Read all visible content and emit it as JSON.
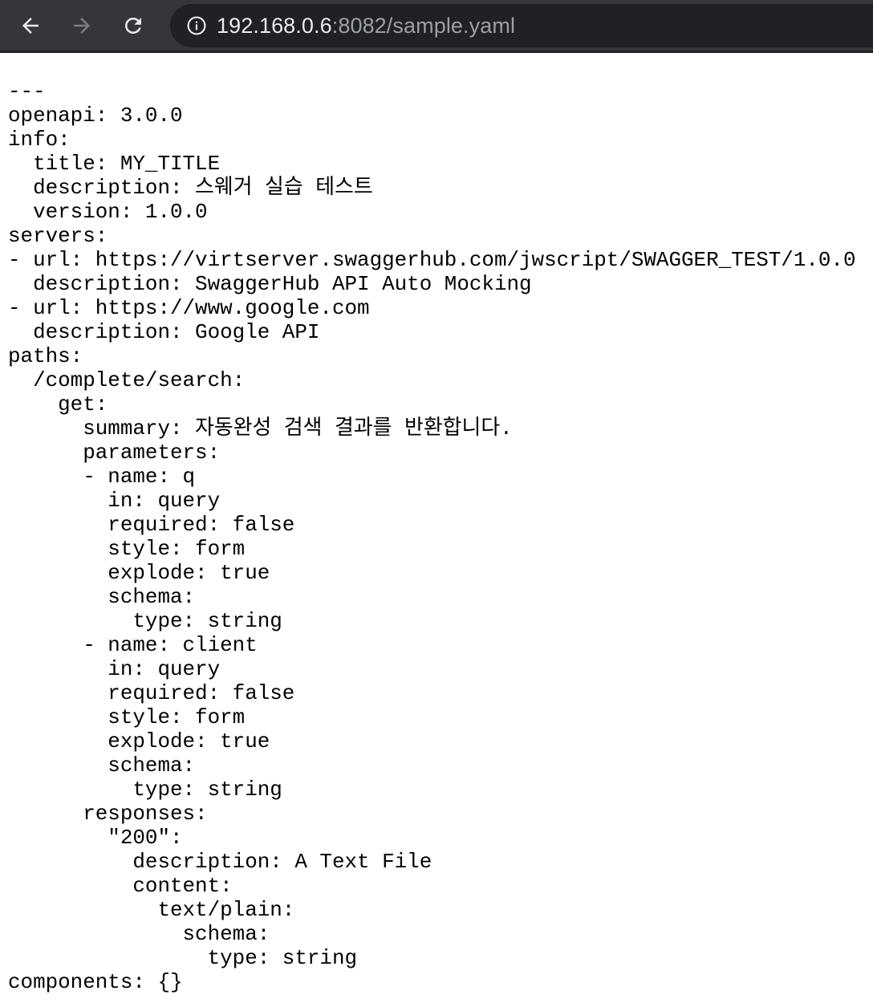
{
  "browser": {
    "back_icon": "arrow-left-icon",
    "forward_icon": "arrow-right-icon",
    "reload_icon": "reload-icon",
    "site_info_icon": "info-icon",
    "address": {
      "host": "192.168.0.6",
      "rest": ":8082/sample.yaml"
    },
    "colors": {
      "toolbar": "#35363a",
      "omnibox": "#202124",
      "host_text": "#e8eaed",
      "rest_text": "#9aa0a6",
      "disabled_icon": "#7b7d80"
    }
  },
  "document": {
    "lines": [
      "---",
      "openapi: 3.0.0",
      "info:",
      "  title: MY_TITLE",
      "  description: 스웨거 실습 테스트",
      "  version: 1.0.0",
      "servers:",
      "- url: https://virtserver.swaggerhub.com/jwscript/SWAGGER_TEST/1.0.0",
      "  description: SwaggerHub API Auto Mocking",
      "- url: https://www.google.com",
      "  description: Google API",
      "paths:",
      "  /complete/search:",
      "    get:",
      "      summary: 자동완성 검색 결과를 반환합니다.",
      "      parameters:",
      "      - name: q",
      "        in: query",
      "        required: false",
      "        style: form",
      "        explode: true",
      "        schema:",
      "          type: string",
      "      - name: client",
      "        in: query",
      "        required: false",
      "        style: form",
      "        explode: true",
      "        schema:",
      "          type: string",
      "      responses:",
      "        \"200\":",
      "          description: A Text File",
      "          content:",
      "            text/plain:",
      "              schema:",
      "                type: string",
      "components: {}"
    ]
  }
}
